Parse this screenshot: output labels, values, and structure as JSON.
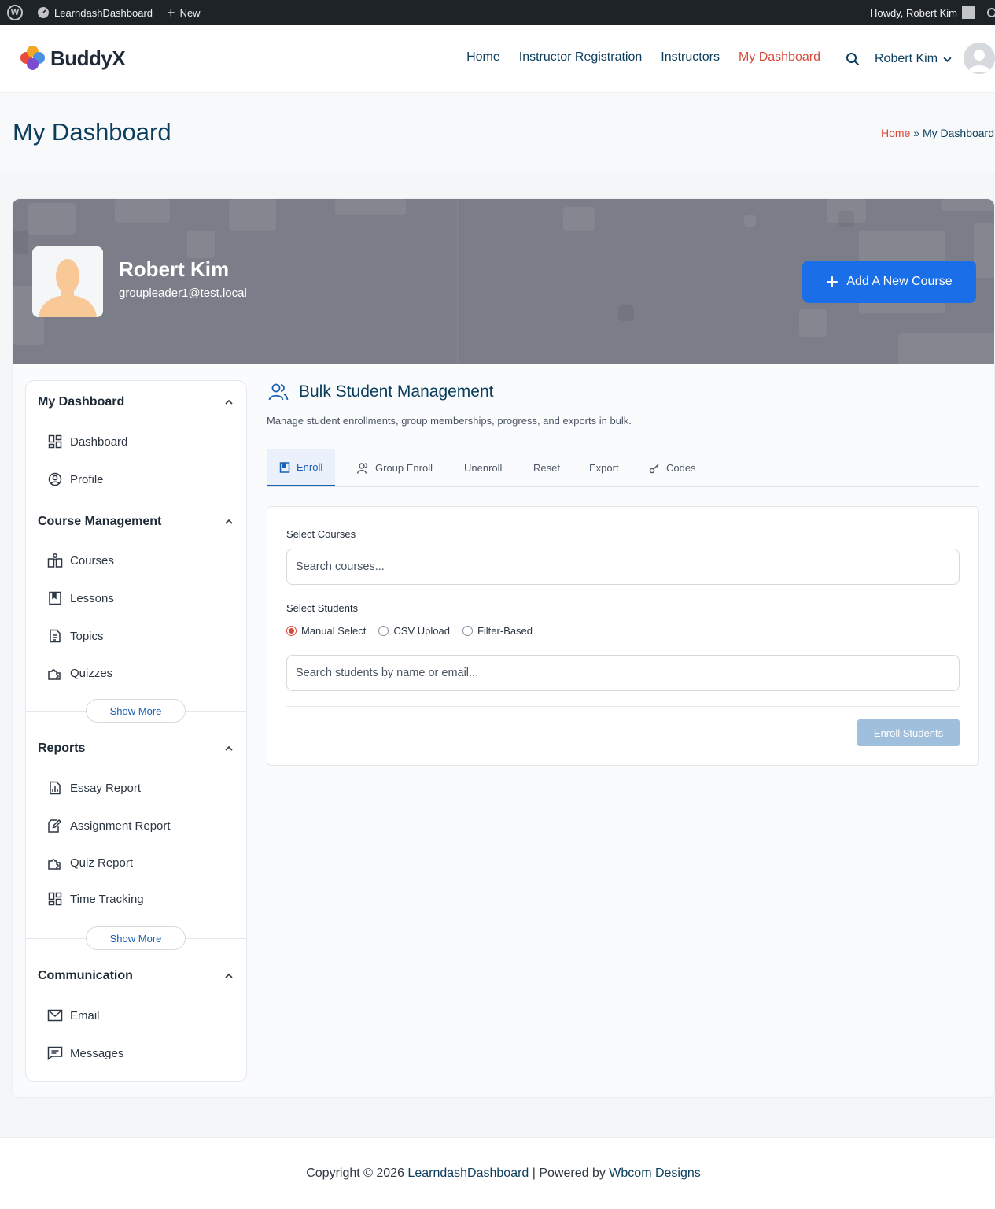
{
  "admin_bar": {
    "site_name": "LearndashDashboard",
    "new_label": "New",
    "howdy": "Howdy, Robert Kim"
  },
  "header": {
    "logo_text": "BuddyX",
    "nav": [
      {
        "label": "Home"
      },
      {
        "label": "Instructor Registration"
      },
      {
        "label": "Instructors"
      },
      {
        "label": "My Dashboard",
        "active": true
      }
    ],
    "user_name": "Robert Kim"
  },
  "page": {
    "title": "My Dashboard",
    "breadcrumb_home": "Home",
    "breadcrumb_sep": "»",
    "breadcrumb_current": "My Dashboard"
  },
  "profile": {
    "name": "Robert Kim",
    "email": "groupleader1@test.local",
    "add_course_label": "Add A New Course"
  },
  "sidebar": {
    "groups": [
      {
        "title": "My Dashboard",
        "items": [
          {
            "label": "Dashboard",
            "icon": "grid-icon"
          },
          {
            "label": "Profile",
            "icon": "user-circle-icon"
          }
        ]
      },
      {
        "title": "Course Management",
        "items": [
          {
            "label": "Courses",
            "icon": "book-open-icon"
          },
          {
            "label": "Lessons",
            "icon": "bookmark-icon"
          },
          {
            "label": "Topics",
            "icon": "document-icon"
          },
          {
            "label": "Quizzes",
            "icon": "puzzle-icon"
          }
        ],
        "show_more": "Show More"
      },
      {
        "title": "Reports",
        "items": [
          {
            "label": "Essay Report",
            "icon": "chart-doc-icon"
          },
          {
            "label": "Assignment Report",
            "icon": "edit-doc-icon"
          },
          {
            "label": "Quiz Report",
            "icon": "puzzle-icon"
          },
          {
            "label": "Time Tracking",
            "icon": "grid-icon"
          }
        ],
        "show_more": "Show More"
      },
      {
        "title": "Communication",
        "items": [
          {
            "label": "Email",
            "icon": "mail-icon"
          },
          {
            "label": "Messages",
            "icon": "message-icon"
          }
        ]
      }
    ]
  },
  "main": {
    "title": "Bulk Student Management",
    "description": "Manage student enrollments, group memberships, progress, and exports in bulk.",
    "tabs": [
      {
        "label": "Enroll",
        "active": true
      },
      {
        "label": "Group Enroll"
      },
      {
        "label": "Unenroll"
      },
      {
        "label": "Reset"
      },
      {
        "label": "Export"
      },
      {
        "label": "Codes"
      }
    ],
    "form": {
      "courses_label": "Select Courses",
      "courses_placeholder": "Search courses...",
      "students_label": "Select Students",
      "modes": [
        {
          "label": "Manual Select",
          "selected": true
        },
        {
          "label": "CSV Upload"
        },
        {
          "label": "Filter-Based"
        }
      ],
      "students_placeholder": "Search students by name or email...",
      "submit_label": "Enroll Students"
    }
  },
  "footer": {
    "prefix": "Copyright © 2026 ",
    "site": "LearndashDashboard",
    "middle": " | Powered by ",
    "powered": "Wbcom Designs"
  },
  "colors": {
    "accent": "#1a6fe8",
    "nav_active": "#d94a3b",
    "title_navy": "#0b3d5c"
  }
}
